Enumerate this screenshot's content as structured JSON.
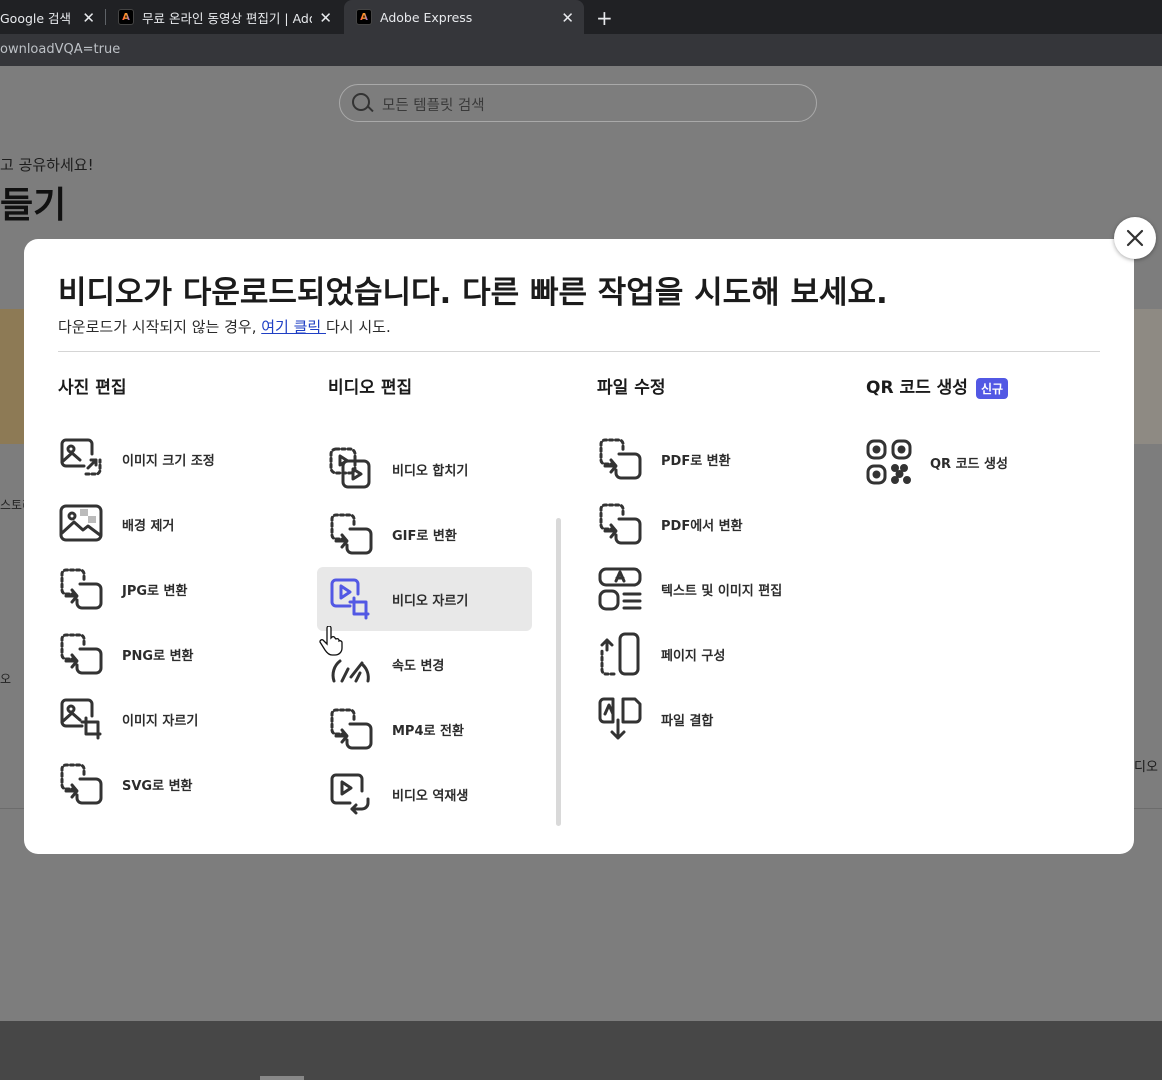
{
  "browser": {
    "tabs": [
      {
        "title": "Google 검색",
        "active": false
      },
      {
        "title": "무료 온라인 동영상 편집기 | Adobe",
        "active": false
      },
      {
        "title": "Adobe Express",
        "active": true
      }
    ],
    "url_fragment": "ownloadVQA=true"
  },
  "background": {
    "search_placeholder": "모든 템플릿 검색",
    "subtitle_fragment": "고 공유하세요!",
    "title_fragment": "들기",
    "left_card_label": "스토리",
    "left_row_label": "오",
    "right_row_label": "디오"
  },
  "modal": {
    "title": "비디오가 다운로드되었습니다. 다른 빠른 작업을 시도해 보세요.",
    "sub_before": "다운로드가 시작되지 않는 경우, ",
    "sub_link": "여기 클릭 ",
    "sub_after": "다시 시도.",
    "columns": {
      "photo": {
        "heading": "사진 편집",
        "items": [
          "이미지 크기 조정",
          "배경 제거",
          "JPG로 변환",
          "PNG로 변환",
          "이미지 자르기",
          "SVG로 변환"
        ]
      },
      "video": {
        "heading": "비디오 편집",
        "items": [
          "비디오 합치기",
          "GIF로 변환",
          "비디오 자르기",
          "속도 변경",
          "MP4로 전환",
          "비디오 역재생"
        ],
        "hovered_item": "비디오 자르기"
      },
      "file": {
        "heading": "파일 수정",
        "items": [
          "PDF로 변환",
          "PDF에서 변환",
          "텍스트 및 이미지 편집",
          "페이지 구성",
          "파일 결합"
        ]
      },
      "qr": {
        "heading": "QR 코드 생성",
        "badge": "신규",
        "items": [
          "QR 코드 생성"
        ]
      }
    }
  },
  "colors": {
    "accent": "#5258e4",
    "link": "#1f3fc4",
    "icon_stroke": "#333333",
    "hover_bg": "#e8e8e8"
  }
}
